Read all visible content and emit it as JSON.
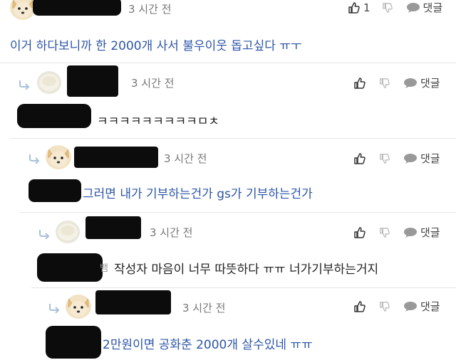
{
  "comments": [
    {
      "time": "3 시간 전",
      "like_count": "1",
      "reply_label": "댓글",
      "text": "이거 하다보니까 한 2000개 사서 불우이웃 돕고싶다 ㅠㅜ",
      "avatar": "dog-avatar"
    },
    {
      "time": "3 시간 전",
      "reply_label": "댓글",
      "text": "ㅋㅋㅋㅋㅋㅋㅋㅋㅋㅁㅊ",
      "avatar": "rice-cake-avatar"
    },
    {
      "time": "3 시간 전",
      "reply_label": "댓글",
      "text": "그러면 내가 기부하는건가 gs가 기부하는건가",
      "avatar": "dog-avatar"
    },
    {
      "time": "3 시간 전",
      "reply_label": "댓글",
      "text_prefix": "뱀",
      "text": "작성자 마음이 너무 따뜻하다 ㅠㅠ 너가기부하는거지",
      "avatar": "rice-cake-avatar"
    },
    {
      "time": "3 시간 전",
      "reply_label": "댓글",
      "text": "2만원이면 공화춘 2000개 살수있네 ㅠㅠ",
      "avatar": "dog-avatar"
    }
  ],
  "colors": {
    "text_blue": "#2c55a6",
    "muted": "#777777",
    "divider": "#e6e6e6",
    "redaction": "#0c0c0c"
  }
}
